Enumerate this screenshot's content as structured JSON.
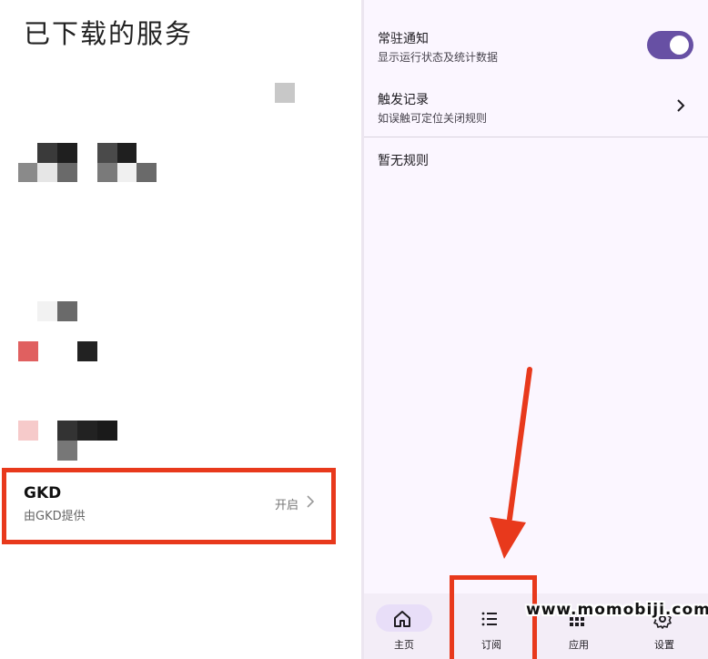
{
  "left_panel": {
    "title": "已下载的服务",
    "service": {
      "name": "GKD",
      "subtitle": "由GKD提供",
      "status": "开启"
    }
  },
  "right_panel": {
    "rows": [
      {
        "title": "常驻通知",
        "subtitle": "显示运行状态及统计数据",
        "toggle_on": true
      },
      {
        "title": "触发记录",
        "subtitle": "如误触可定位关闭规则"
      }
    ],
    "empty_rules": "暂无规则"
  },
  "bottom_nav": {
    "items": [
      {
        "label": "主页",
        "icon": "home-icon",
        "active": true
      },
      {
        "label": "订阅",
        "icon": "list-icon",
        "active": false
      },
      {
        "label": "应用",
        "icon": "apps-grid-icon",
        "active": false
      },
      {
        "label": "设置",
        "icon": "gear-icon",
        "active": false
      }
    ]
  },
  "watermark": "www.momobiji.com",
  "colors": {
    "accent": "#6750a4",
    "highlight_red": "#e8391c",
    "nav_active": "#e8def8"
  }
}
